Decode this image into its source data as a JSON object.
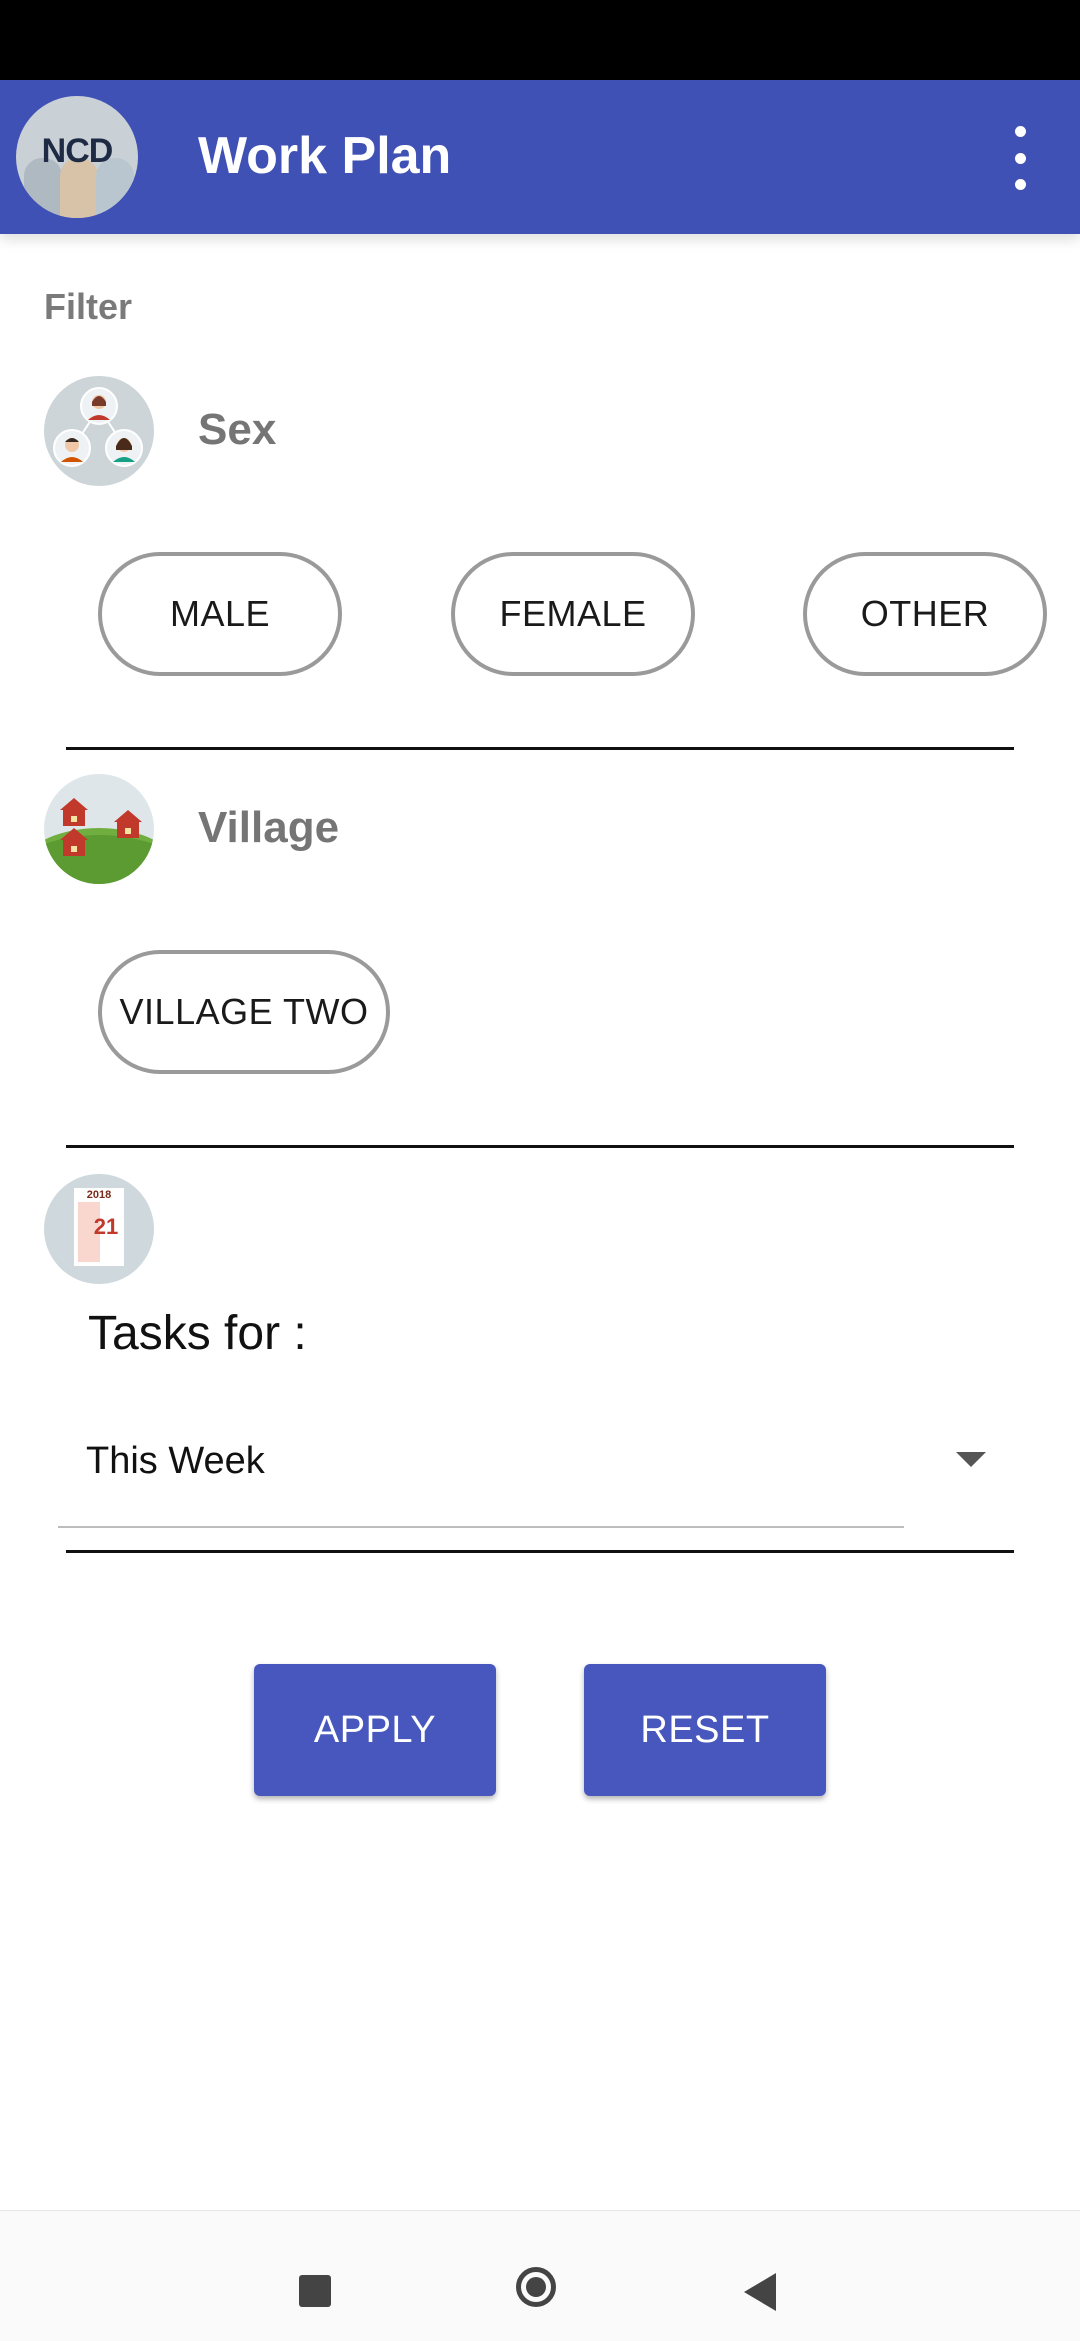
{
  "app_bar": {
    "title": "Work Plan",
    "logo_text": "NCD",
    "menu_icon": "more-vert-icon",
    "background_color": "#4051b5"
  },
  "filter": {
    "label": "Filter"
  },
  "sex_section": {
    "title": "Sex",
    "icon": "people-group-icon",
    "options": [
      "MALE",
      "FEMALE",
      "OTHER"
    ]
  },
  "village_section": {
    "title": "Village",
    "icon": "village-houses-icon",
    "options": [
      "VILLAGE TWO"
    ]
  },
  "tasks_section": {
    "icon": "calendar-icon",
    "calendar_year": "2018",
    "calendar_day": "21",
    "label": "Tasks for :",
    "selected_period": "This Week"
  },
  "actions": {
    "apply_label": "APPLY",
    "reset_label": "RESET",
    "button_color": "#4757bd"
  },
  "system_nav": {
    "icons": [
      "recent-apps-icon",
      "home-icon",
      "back-icon"
    ]
  }
}
